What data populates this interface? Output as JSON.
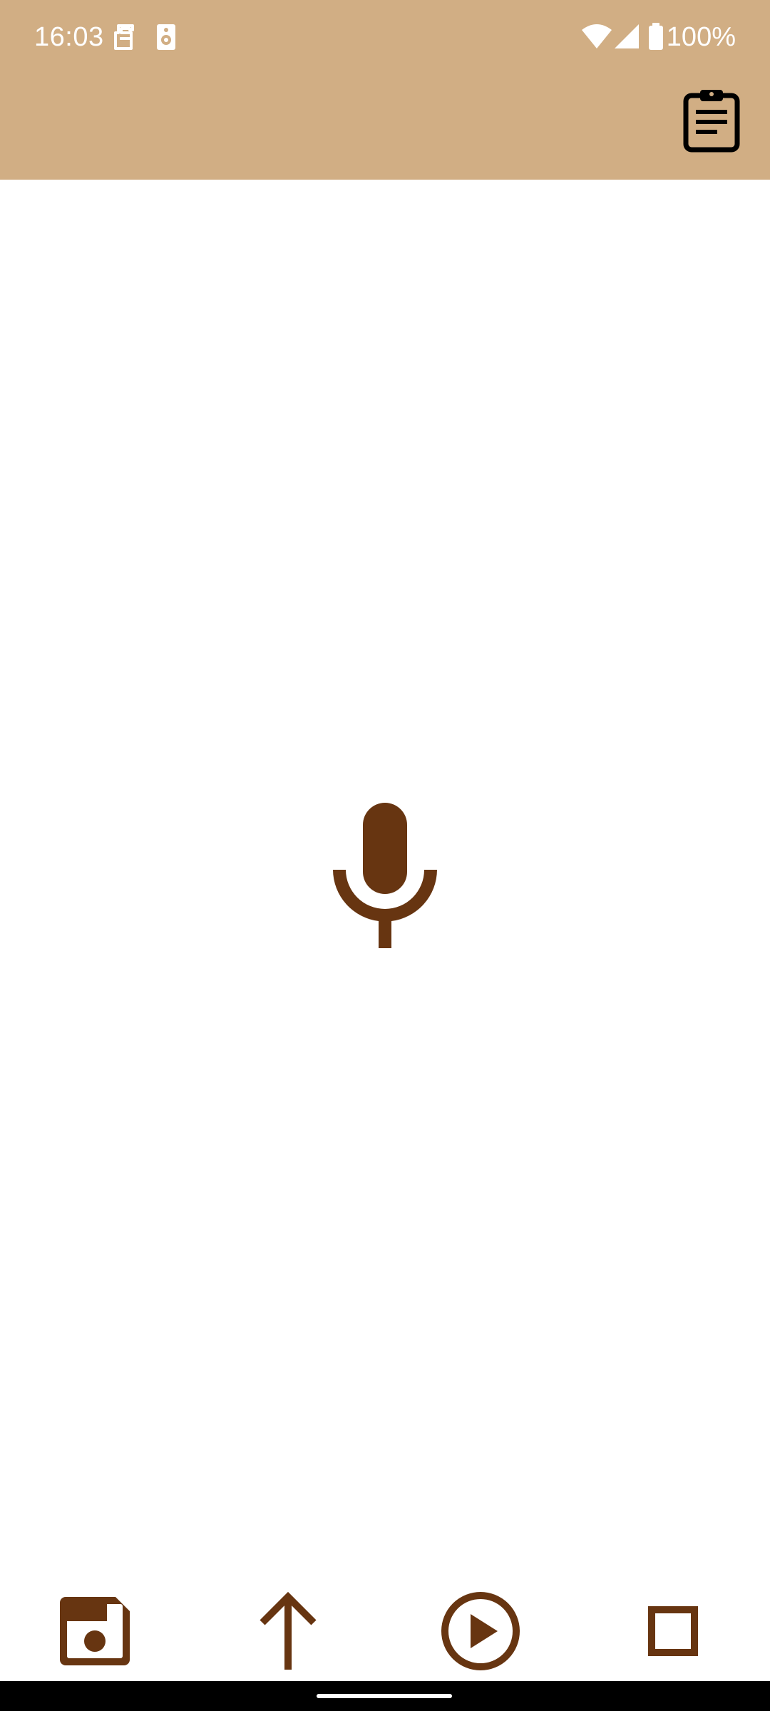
{
  "colors": {
    "header_bg": "#D1AE84",
    "accent_brown": "#673511",
    "icon_black": "#000000",
    "nav_bg": "#000000"
  },
  "status_bar": {
    "time": "16:03",
    "battery_percent": "100%",
    "icons": [
      "notification-icon",
      "speaker-icon",
      "wifi-icon",
      "cellular-signal-icon",
      "battery-icon"
    ]
  },
  "header": {
    "action_icon": "clipboard-icon"
  },
  "main": {
    "center_icon": "microphone-icon"
  },
  "toolbar": {
    "buttons": [
      {
        "icon": "save-icon"
      },
      {
        "icon": "arrow-up-icon"
      },
      {
        "icon": "play-icon"
      },
      {
        "icon": "stop-icon"
      }
    ]
  }
}
